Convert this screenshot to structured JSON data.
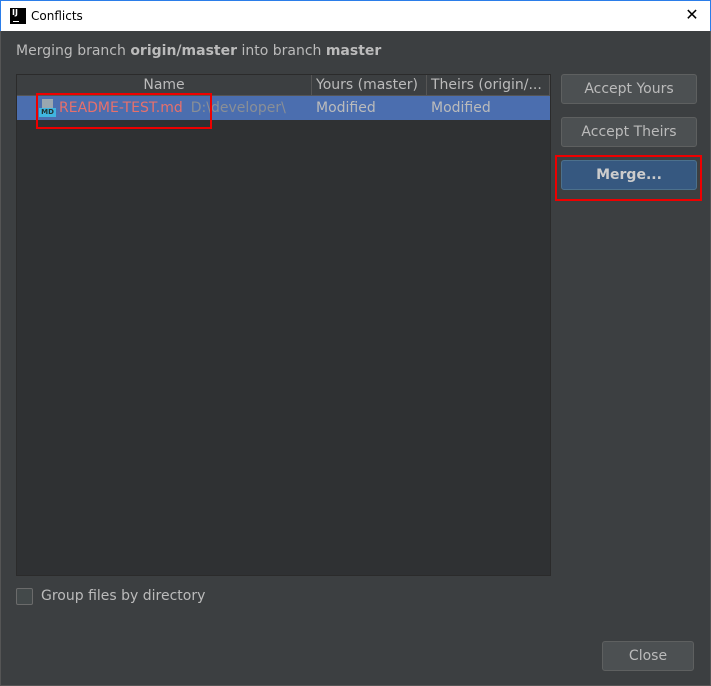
{
  "window": {
    "title": "Conflicts",
    "app_icon": "IJ"
  },
  "heading": {
    "prefix": "Merging branch ",
    "source": "origin/master",
    "middle": " into branch ",
    "target": "master"
  },
  "table": {
    "columns": [
      "Name",
      "Yours (master)",
      "Theirs (origin/..."
    ],
    "rows": [
      {
        "icon": "markdown-file-icon",
        "icon_label": "MD",
        "name": "README-TEST.md",
        "path": "D:\\developer\\",
        "yours": "Modified",
        "theirs": "Modified"
      }
    ]
  },
  "buttons": {
    "accept_yours": "Accept Yours",
    "accept_theirs": "Accept Theirs",
    "merge": "Merge...",
    "close": "Close"
  },
  "options": {
    "group_by_directory": {
      "label": "Group files by directory",
      "checked": false
    }
  },
  "colors": {
    "background": "#3c3f41",
    "selection": "#4b6eaf",
    "conflict_file": "#e8706b",
    "highlight": "#ee0000"
  }
}
